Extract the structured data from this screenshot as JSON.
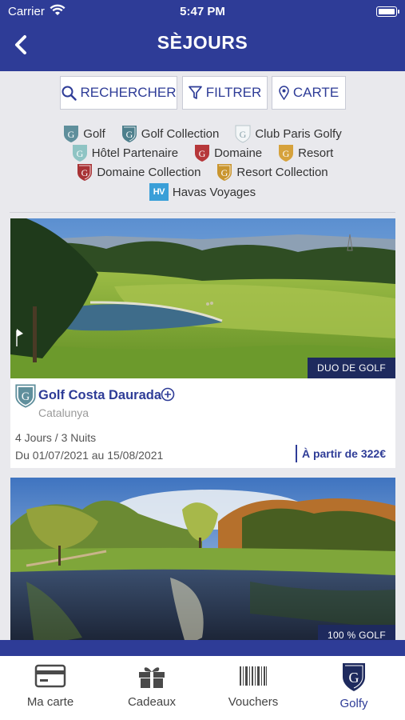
{
  "status_bar": {
    "carrier": "Carrier",
    "time": "5:47 PM"
  },
  "header": {
    "title": "SÈJOURS"
  },
  "toolbar": {
    "search_label": "RECHERCHER",
    "filter_label": "FILTRER",
    "map_label": "CARTE"
  },
  "legend": {
    "golf": "Golf",
    "golf_collection": "Golf Collection",
    "club_paris_golfy": "Club Paris Golfy",
    "hotel_partenaire": "Hôtel Partenaire",
    "domaine": "Domaine",
    "resort": "Resort",
    "domaine_collection": "Domaine Collection",
    "resort_collection": "Resort Collection",
    "havas_voyages": "Havas Voyages",
    "hv_logo": "HV"
  },
  "colors": {
    "primary": "#2e3c97",
    "golf": "#5f8f9c",
    "club": "#cfd8dc",
    "hotel": "#8fc4c4",
    "domaine": "#b6373a",
    "resort": "#d6a23c",
    "havas": "#3a9fd8"
  },
  "cards": [
    {
      "badge": "DUO DE GOLF",
      "name": "Golf Costa Daurada",
      "region": "Catalunya",
      "duration": "4 Jours / 3 Nuits",
      "dates": "Du 01/07/2021 au 15/08/2021",
      "price": "À partir de 322€"
    },
    {
      "badge": "100 % GOLF"
    }
  ],
  "tabs": [
    {
      "label": "Ma carte",
      "icon": "card-icon"
    },
    {
      "label": "Cadeaux",
      "icon": "gift-icon"
    },
    {
      "label": "Vouchers",
      "icon": "barcode-icon"
    },
    {
      "label": "Golfy",
      "icon": "golfy-shield-icon"
    }
  ]
}
